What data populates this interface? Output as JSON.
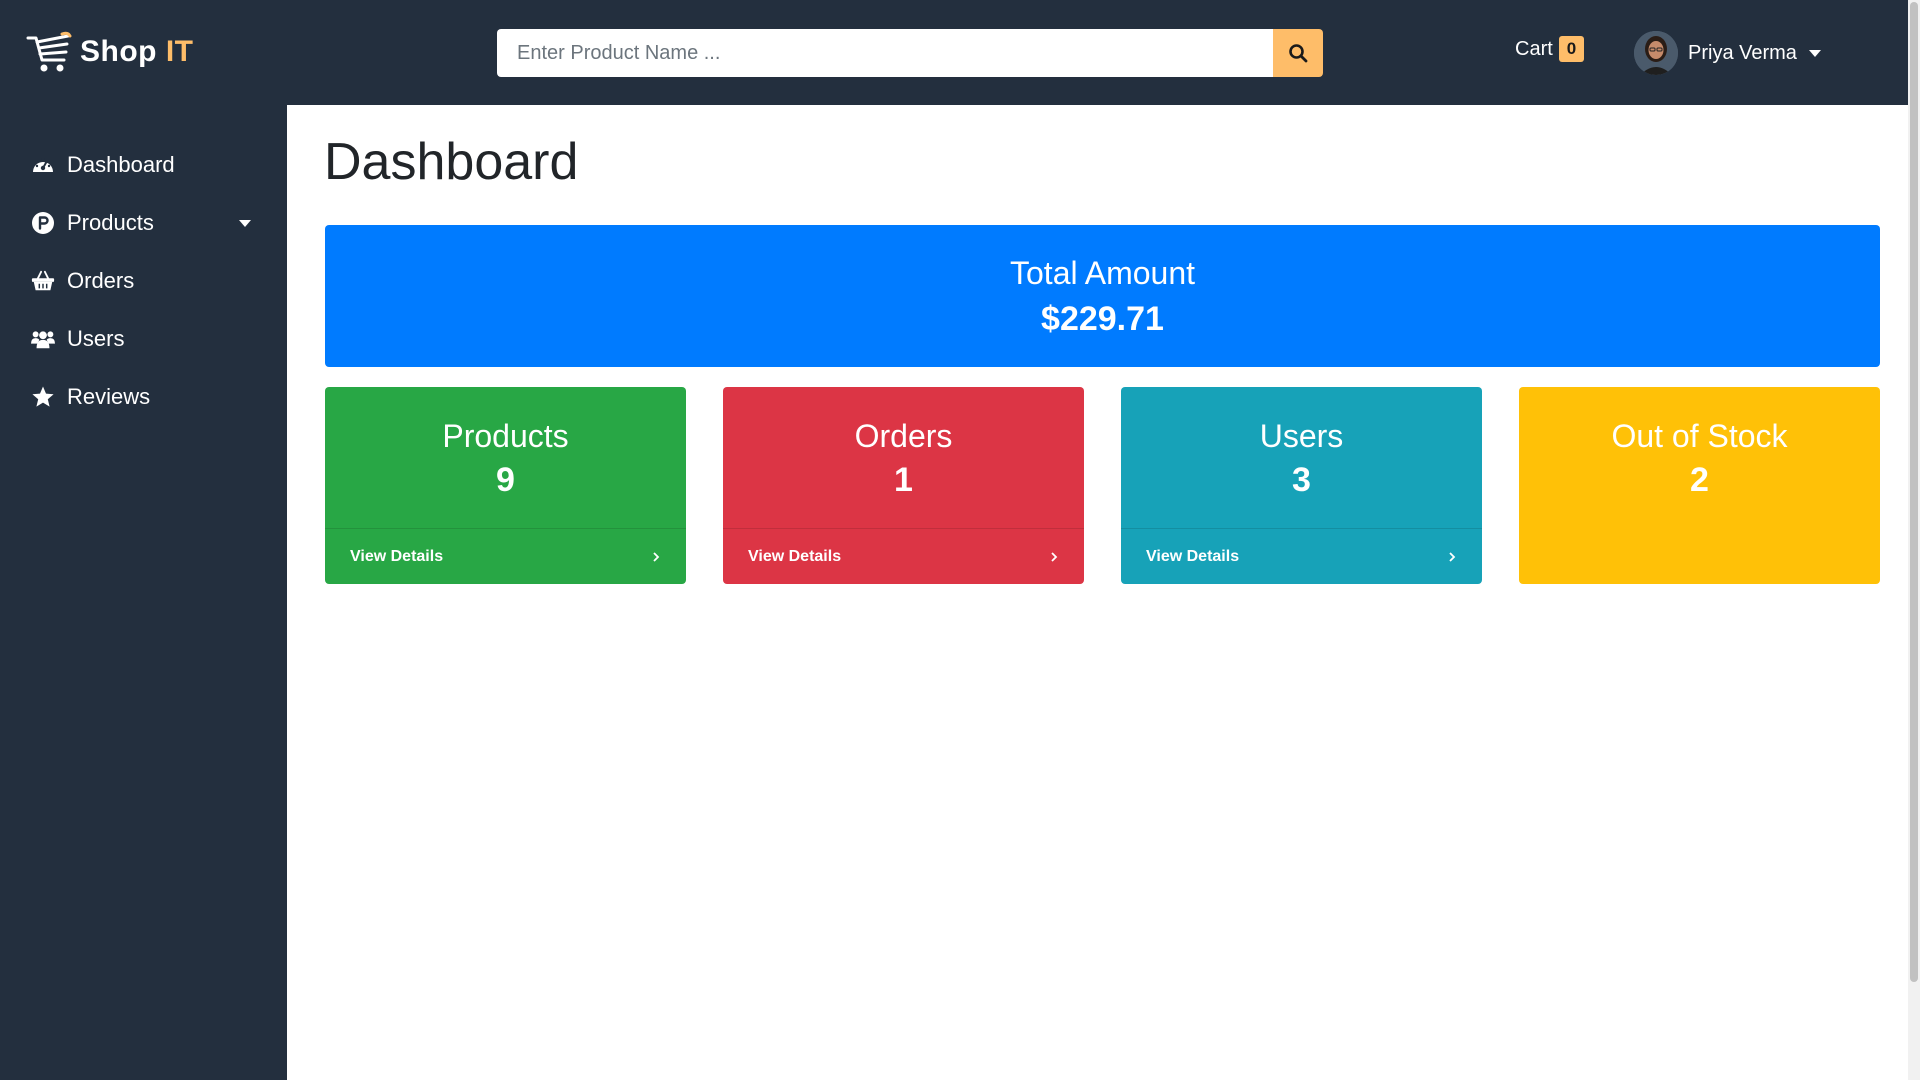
{
  "brand": {
    "name_main": "Shop",
    "name_accent": "IT"
  },
  "search": {
    "placeholder": "Enter Product Name ..."
  },
  "cart": {
    "label": "Cart",
    "count": "0"
  },
  "user": {
    "name": "Priya Verma"
  },
  "sidebar": {
    "items": [
      {
        "label": "Dashboard",
        "icon": "tachometer-icon"
      },
      {
        "label": "Products",
        "icon": "product-icon"
      },
      {
        "label": "Orders",
        "icon": "shopping-basket-icon"
      },
      {
        "label": "Users",
        "icon": "users-icon"
      },
      {
        "label": "Reviews",
        "icon": "star-icon"
      }
    ]
  },
  "page": {
    "title": "Dashboard"
  },
  "total": {
    "label": "Total Amount",
    "value": "$229.71"
  },
  "stats": [
    {
      "label": "Products",
      "value": "9",
      "link": "View Details",
      "color": "#28a745"
    },
    {
      "label": "Orders",
      "value": "1",
      "link": "View Details",
      "color": "#dc3545"
    },
    {
      "label": "Users",
      "value": "3",
      "link": "View Details",
      "color": "#17a2b8"
    },
    {
      "label": "Out of Stock",
      "value": "2",
      "color": "#ffc107"
    }
  ],
  "colors": {
    "navbar": "#232f3e",
    "accent": "#febd69",
    "primary": "#007bff"
  }
}
